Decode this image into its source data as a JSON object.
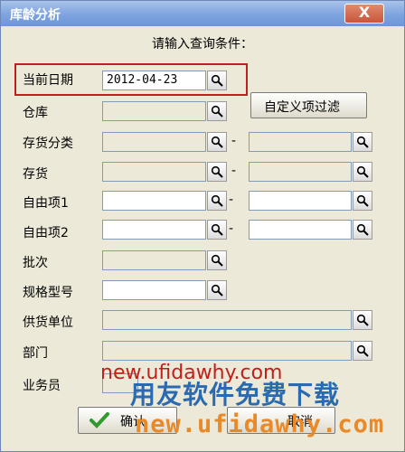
{
  "window": {
    "title": "库龄分析",
    "close_symbol": "X"
  },
  "heading": "请输入查询条件：",
  "fields": {
    "current_date": {
      "label": "当前日期",
      "value": "2012-04-23"
    },
    "warehouse": {
      "label": "仓库"
    },
    "inventory_category": {
      "label": "存货分类",
      "separator": "-"
    },
    "inventory": {
      "label": "存货",
      "separator": "-"
    },
    "free_item_1": {
      "label": "自由项1",
      "separator": "-"
    },
    "free_item_2": {
      "label": "自由项2",
      "separator": "-"
    },
    "batch": {
      "label": "批次"
    },
    "spec_model": {
      "label": "规格型号"
    },
    "supplier": {
      "label": "供货单位"
    },
    "department": {
      "label": "部门"
    },
    "salesperson": {
      "label": "业务员"
    }
  },
  "buttons": {
    "custom_filter": "自定义项过滤",
    "ok": "确认",
    "cancel": "取消"
  },
  "watermark": {
    "url_top": "new.ufidawhy.com",
    "slogan": "用友软件免费下载",
    "url_bottom": "new.ufidawhy.com"
  },
  "colors": {
    "highlight": "#c0201d",
    "titlebar": "#7ea3df",
    "window_bg": "#ece9d8"
  },
  "icons": {
    "search": "magnifier-icon",
    "ok": "check-icon",
    "cancel": "cancel-icon"
  }
}
